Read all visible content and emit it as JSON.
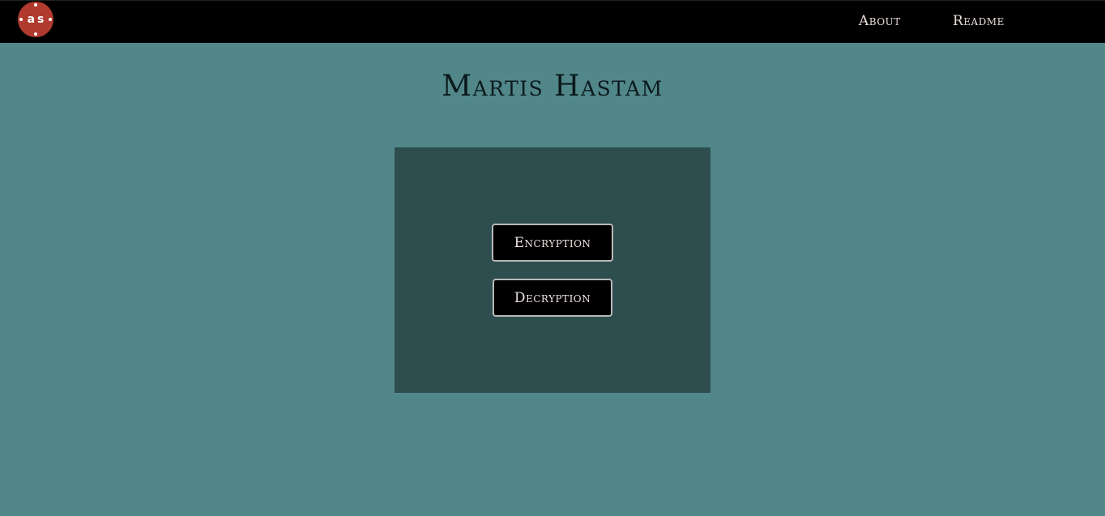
{
  "header": {
    "logo_text": "as",
    "nav": {
      "about_label": "About",
      "readme_label": "Readme"
    }
  },
  "main": {
    "title": "Martis Hastam",
    "buttons": {
      "encryption_label": "Encryption",
      "decryption_label": "Decryption"
    }
  },
  "colors": {
    "page_background": "#52878a",
    "navbar_background": "#000000",
    "logo_background": "#b13a2e",
    "panel_background": "#2d4d4e",
    "button_background": "#000000",
    "button_border": "#b8b8b8",
    "nav_text": "#e8dcd8",
    "title_text": "#0b1a1c"
  }
}
